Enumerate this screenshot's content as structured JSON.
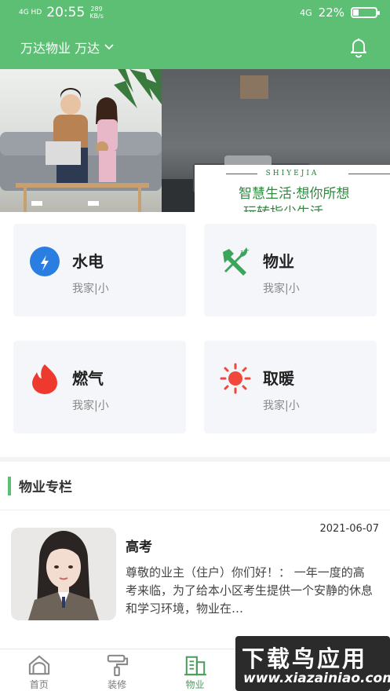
{
  "status_bar": {
    "network": "4G HD",
    "time": "20:55",
    "speed_value": "289",
    "speed_unit": "KB/s",
    "network_right": "4G",
    "battery": "22%"
  },
  "header": {
    "location": "万达物业 万达",
    "bell_icon": "bell-icon"
  },
  "banner": {
    "brand": "SHIYEJIA",
    "line1": "智慧生活·想你所想",
    "line2": "玩转指尖生活"
  },
  "services": [
    {
      "title": "水电",
      "subtitle": "我家|小",
      "icon": "water-drop-icon",
      "color": "#2a7de1"
    },
    {
      "title": "物业",
      "subtitle": "我家|小",
      "icon": "tools-icon",
      "color": "#3aa55b"
    },
    {
      "title": "燃气",
      "subtitle": "我家|小",
      "icon": "flame-icon",
      "color": "#ee3a2e"
    },
    {
      "title": "取暖",
      "subtitle": "我家|小",
      "icon": "sun-icon",
      "color": "#f0483a"
    }
  ],
  "column": {
    "title": "物业专栏",
    "article": {
      "date": "2021-06-07",
      "title": "高考",
      "body": "尊敬的业主（住户）你们好！：  一年一度的高考来临，为了给本小区考生提供一个安静的休息和学习环境，物业在…"
    }
  },
  "tabbar": {
    "tabs": [
      {
        "label": "首页",
        "icon": "home-icon"
      },
      {
        "label": "装修",
        "icon": "paint-roller-icon"
      },
      {
        "label": "物业",
        "icon": "building-icon"
      },
      {
        "label": "",
        "icon": "tab-icon"
      },
      {
        "label": "",
        "icon": "tab-icon"
      }
    ]
  },
  "watermark": {
    "line1": "下载鸟应用",
    "line2": "www.xiazainiao.com"
  },
  "colors": {
    "accent": "#5dbf73",
    "active_tab": "#4c9d5d"
  }
}
